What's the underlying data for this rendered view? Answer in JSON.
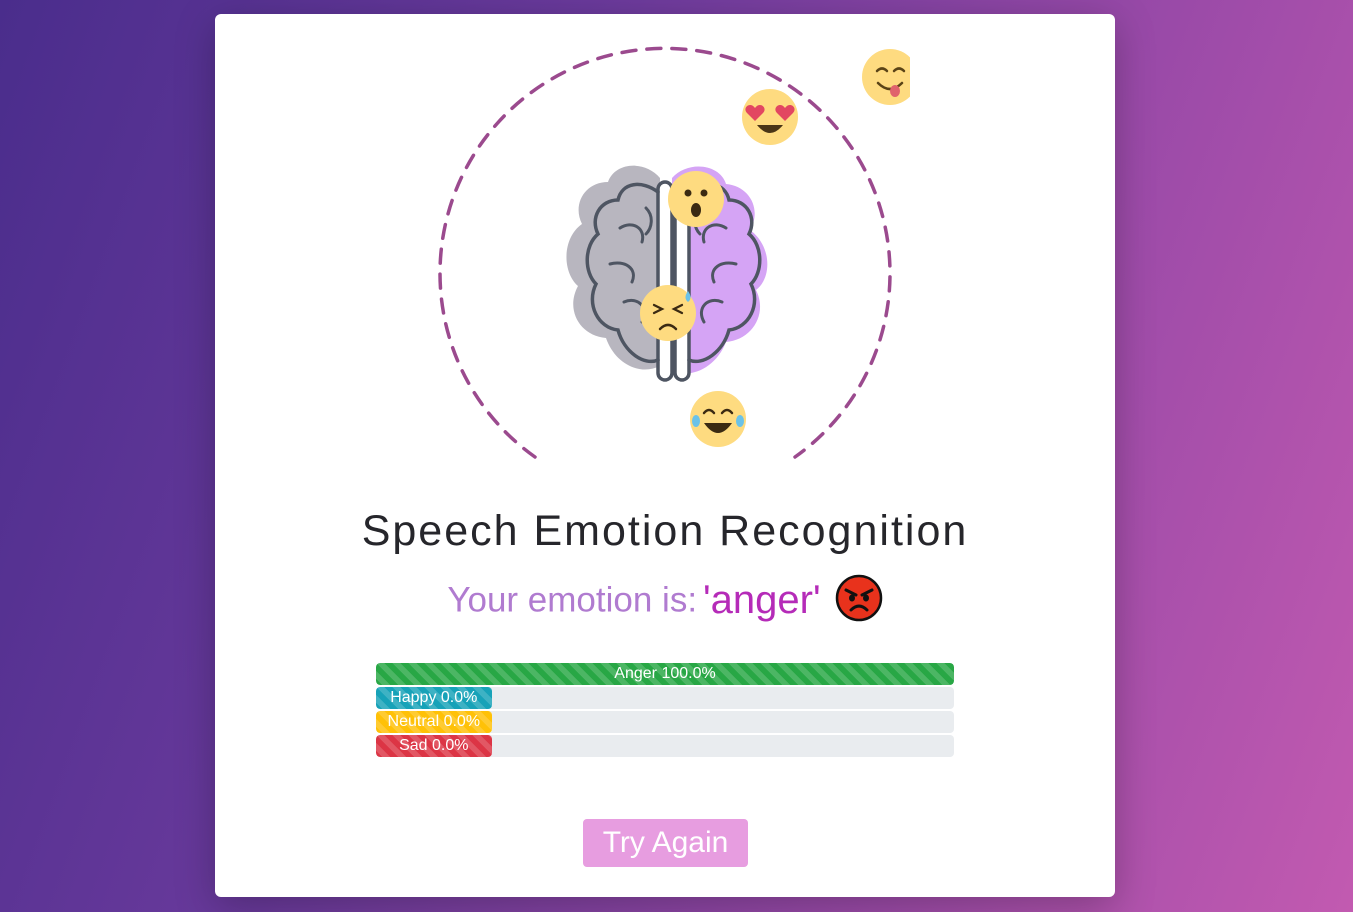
{
  "title": "Speech Emotion Recognition",
  "result": {
    "prefix": "Your emotion is:",
    "emotion": "'anger'"
  },
  "bars": [
    {
      "name": "Anger",
      "label": "Anger 100.0%",
      "percent": 100.0,
      "color": "#28a745"
    },
    {
      "name": "Happy",
      "label": "Happy 0.0%",
      "percent": 0.0,
      "color": "#17a2b8"
    },
    {
      "name": "Neutral",
      "label": "Neutral 0.0%",
      "percent": 0.0,
      "color": "#ffc107"
    },
    {
      "name": "Sad",
      "label": "Sad 0.0%",
      "percent": 0.0,
      "color": "#dc3545"
    }
  ],
  "try_again": "Try Again",
  "colors": {
    "accent": "#b52bb8",
    "button": "#e79de0",
    "dashed_ring": "#9b4a8e",
    "brain_left": "#b8b6bf",
    "brain_right": "#d5a4f5"
  },
  "icons": [
    "brain-icon",
    "smiling-tongue-emoji",
    "heart-eyes-emoji",
    "angry-emoji",
    "surprised-emoji",
    "winking-emoji",
    "nervous-emoji",
    "sad-emoji",
    "laughing-tears-emoji",
    "nauseated-emoji",
    "pouting-face-emoji"
  ]
}
